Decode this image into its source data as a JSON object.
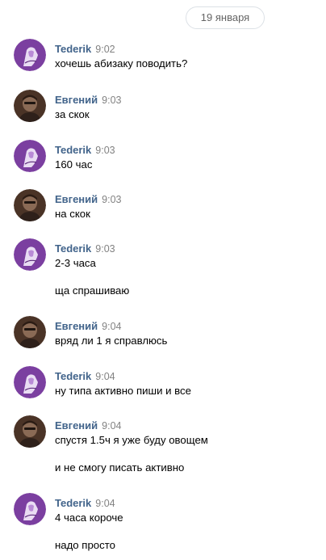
{
  "date_divider": "19 января",
  "messages": [
    {
      "author": "Tederik",
      "time": "9:02",
      "avatar": "tederik-avatar",
      "lines": [
        "хочешь абизаку поводить?"
      ]
    },
    {
      "author": "Евгений",
      "time": "9:03",
      "avatar": "evgeniy-avatar",
      "lines": [
        "за скок"
      ]
    },
    {
      "author": "Tederik",
      "time": "9:03",
      "avatar": "tederik-avatar",
      "lines": [
        "160 час"
      ]
    },
    {
      "author": "Евгений",
      "time": "9:03",
      "avatar": "evgeniy-avatar",
      "lines": [
        "на скок"
      ]
    },
    {
      "author": "Tederik",
      "time": "9:03",
      "avatar": "tederik-avatar",
      "lines": [
        "2-3 часа",
        "ща спрашиваю"
      ]
    },
    {
      "author": "Евгений",
      "time": "9:04",
      "avatar": "evgeniy-avatar",
      "lines": [
        "вряд ли 1 я справлюсь"
      ]
    },
    {
      "author": "Tederik",
      "time": "9:04",
      "avatar": "tederik-avatar",
      "lines": [
        "ну типа активно пиши и все"
      ]
    },
    {
      "author": "Евгений",
      "time": "9:04",
      "avatar": "evgeniy-avatar",
      "lines": [
        "спустя 1.5ч я уже буду овощем",
        "и не смогу писать активно"
      ]
    },
    {
      "author": "Tederik",
      "time": "9:04",
      "avatar": "tederik-avatar",
      "lines": [
        "4 часа короче",
        "надо просто"
      ]
    }
  ],
  "colors": {
    "author_name": "#42648b",
    "time": "#828282",
    "tederik_avatar": "#7b3fa0",
    "evgeniy_avatar": "#4a3326"
  }
}
